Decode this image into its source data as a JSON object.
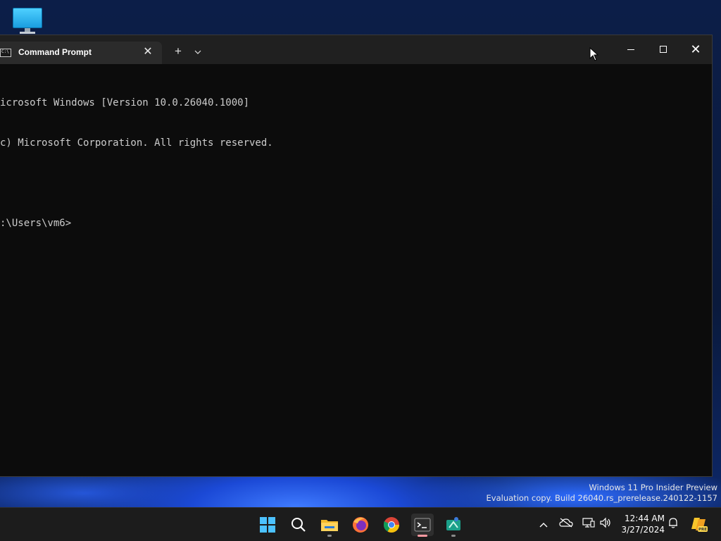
{
  "desktop": {
    "icon_name": "this-pc-icon"
  },
  "window": {
    "tab_title": "Command Prompt",
    "tab_icon_label": "C:\\",
    "tab_close_symbol": "✕",
    "new_tab_symbol": "+",
    "tab_dropdown_symbol": "⌄",
    "close_symbol": "✕"
  },
  "console": {
    "lines": [
      "icrosoft Windows [Version 10.0.26040.1000]",
      "c) Microsoft Corporation. All rights reserved.",
      "",
      ":\\Users\\vm6>"
    ]
  },
  "watermark": {
    "line1": "Windows 11 Pro Insider Preview",
    "line2": "Evaluation copy. Build 26040.rs_prerelease.240122-1157"
  },
  "taskbar": {
    "apps": [
      {
        "name": "start-button",
        "icon": "windows-logo-icon"
      },
      {
        "name": "search-button",
        "icon": "search-icon"
      },
      {
        "name": "file-explorer",
        "icon": "folder-icon"
      },
      {
        "name": "firefox",
        "icon": "firefox-icon"
      },
      {
        "name": "chrome",
        "icon": "chrome-icon"
      },
      {
        "name": "terminal",
        "icon": "terminal-icon"
      },
      {
        "name": "snipping-tool",
        "icon": "snipping-tool-icon"
      }
    ],
    "time": "12:44 AM",
    "date": "3/27/2024",
    "pre_badge": "PRE"
  },
  "colors": {
    "terminal_bg": "#0c0c0c",
    "terminal_text": "#cccccc",
    "titlebar": "#202020",
    "tab_active": "#2b2b2b",
    "accent": "#4cc2ff"
  }
}
